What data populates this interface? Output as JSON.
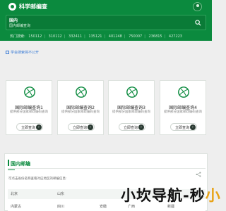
{
  "header": {
    "site_title": "科学邮编查",
    "search": {
      "title": "国内",
      "placeholder": "国内邮编查询"
    },
    "hot": {
      "label": "热门搜索:",
      "items": [
        "150112",
        "310112",
        "332411",
        "135121",
        "401248",
        "750007",
        "236815",
        "427223"
      ]
    }
  },
  "notice": "学会搜索将不公开",
  "cards": [
    {
      "title": "国际邮编查询1",
      "desc": "提供部分国家邮政编码查询",
      "button": "立即查询"
    },
    {
      "title": "国际邮编查询2",
      "desc": "提供部分国家邮政编码查询",
      "button": "立即查询"
    },
    {
      "title": "国际邮编查询3",
      "desc": "提供部分国家邮政编码查询",
      "button": "立即查询"
    },
    {
      "title": "国际邮编查询4",
      "desc": "提供部分国家邮政编码查询",
      "button": "立即查询"
    }
  ],
  "domestic": {
    "title": "国内邮编",
    "desc": "可点击省份名称查看对应地区的邮编信息:",
    "rows": [
      [
        "北京",
        "山东",
        "",
        "",
        ""
      ],
      [
        "内蒙古",
        "四川",
        "安徽",
        "广西",
        "新疆"
      ]
    ]
  },
  "watermark": {
    "part1": "小坎导航",
    "part2": "-秒",
    "part3": "小"
  },
  "colors": {
    "brand": "#0b8a3e",
    "link": "#3a7bd5"
  }
}
